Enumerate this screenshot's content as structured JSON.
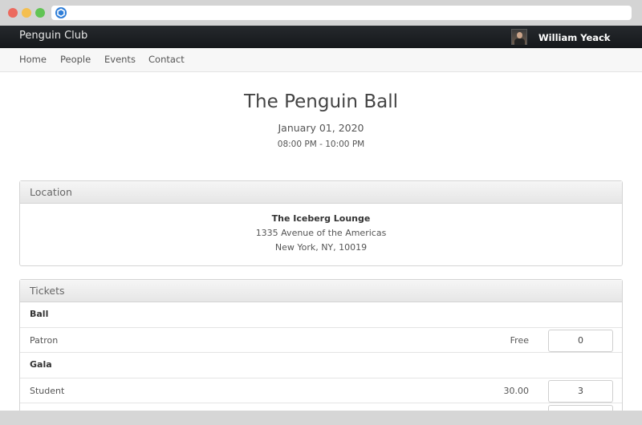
{
  "navbar": {
    "brand": "Penguin Club",
    "user_name": "William Yeack"
  },
  "subnav": {
    "items": [
      "Home",
      "People",
      "Events",
      "Contact"
    ]
  },
  "event": {
    "title": "The Penguin Ball",
    "date": "January 01, 2020",
    "time": "08:00 PM - 10:00 PM"
  },
  "location": {
    "heading": "Location",
    "venue": "The Iceberg Lounge",
    "street": "1335 Avenue of the Americas",
    "city": "New York, NY, 10019"
  },
  "tickets": {
    "heading": "Tickets",
    "groups": [
      {
        "name": "Ball",
        "items": [
          {
            "name": "Patron",
            "price": "Free",
            "quantity": "0"
          }
        ]
      },
      {
        "name": "Gala",
        "items": [
          {
            "name": "Student",
            "price": "30.00",
            "quantity": "3"
          }
        ]
      }
    ]
  }
}
